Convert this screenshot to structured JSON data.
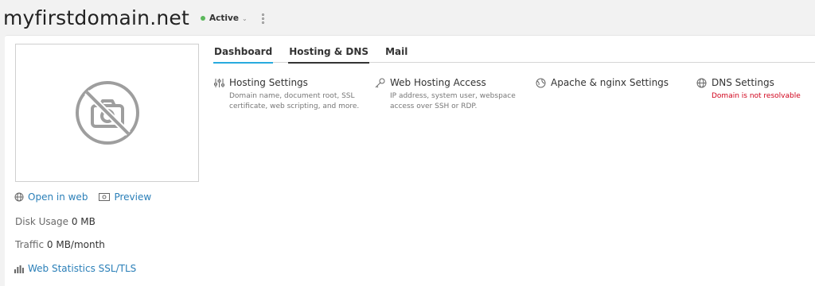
{
  "header": {
    "domain": "myfirstdomain.net",
    "status": "Active",
    "status_color": "#5cb85c"
  },
  "left": {
    "open_in_web": "Open in web",
    "preview": "Preview",
    "disk_usage_label": "Disk Usage",
    "disk_usage_value": "0 MB",
    "traffic_label": "Traffic",
    "traffic_value": "0 MB/month",
    "web_stats": "Web Statistics SSL/TLS"
  },
  "tabs": [
    {
      "label": "Dashboard"
    },
    {
      "label": "Hosting & DNS"
    },
    {
      "label": "Mail"
    }
  ],
  "tools": [
    {
      "title": "Hosting Settings",
      "desc": "Domain name, document root, SSL certificate, web scripting, and more.",
      "icon": "sliders-icon"
    },
    {
      "title": "Web Hosting Access",
      "desc": "IP address, system user, webspace access over SSH or RDP.",
      "icon": "key-icon"
    },
    {
      "title": "Apache & nginx Settings",
      "desc": "",
      "icon": "gear-globe-icon"
    },
    {
      "title": "DNS Settings",
      "desc": "Domain is not resolvable",
      "icon": "globe-icon"
    }
  ],
  "colors": {
    "accent": "#28aade",
    "link": "#2a7fb8",
    "error": "#d0021b"
  }
}
